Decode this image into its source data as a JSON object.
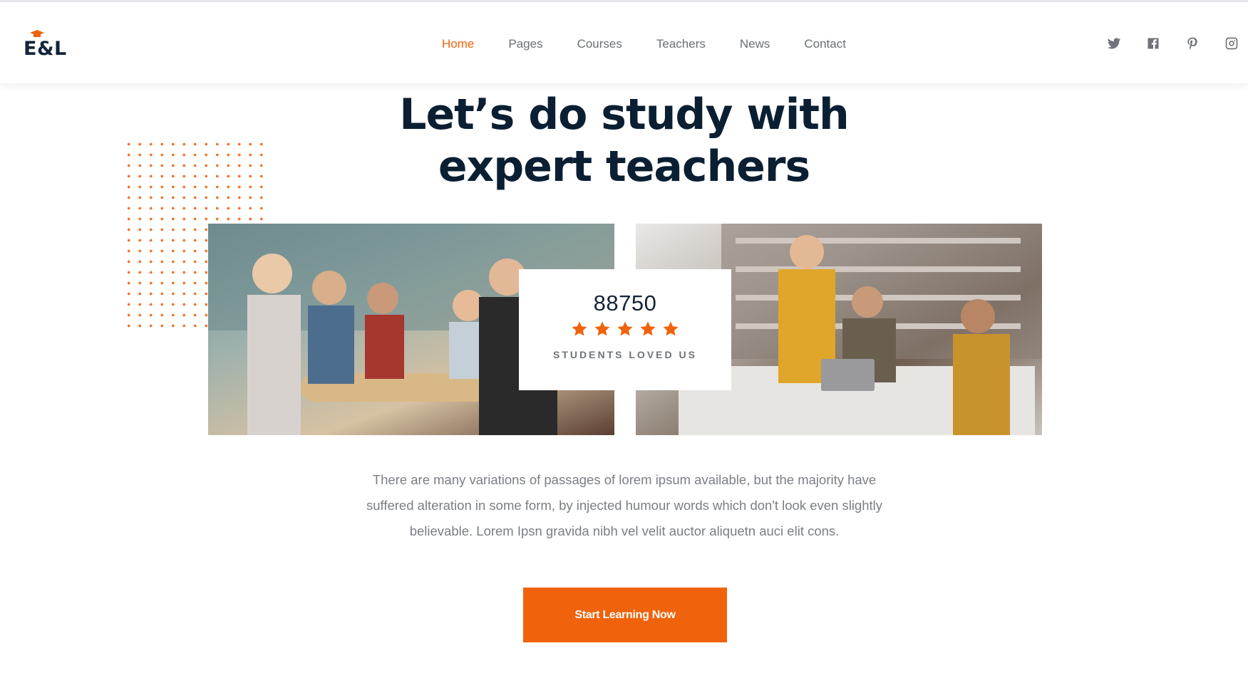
{
  "brand": {
    "logo_text": "E&L",
    "accent_color": "#f0630c",
    "heading_color": "#0b1f33"
  },
  "nav": {
    "items": [
      {
        "label": "Home",
        "active": true
      },
      {
        "label": "Pages",
        "active": false
      },
      {
        "label": "Courses",
        "active": false
      },
      {
        "label": "Teachers",
        "active": false
      },
      {
        "label": "News",
        "active": false
      },
      {
        "label": "Contact",
        "active": false
      }
    ]
  },
  "social": {
    "icons": [
      "twitter-icon",
      "facebook-icon",
      "pinterest-icon",
      "instagram-icon"
    ]
  },
  "hero": {
    "title_line1": "Let’s do study with",
    "title_line2": "expert teachers"
  },
  "images": {
    "left": "students-classroom-photo",
    "right": "students-library-photo"
  },
  "stats": {
    "number": "88750",
    "rating_stars": 5,
    "label": "STUDENTS LOVED US"
  },
  "description": {
    "line1": "There are many variations of passages of lorem ipsum available, but the majority have",
    "line2": "suffered alteration in some form, by injected humour words which don't look even slightly",
    "line3": "believable. Lorem Ipsn gravida nibh vel velit auctor aliquetn auci elit cons."
  },
  "cta": {
    "label": "Start Learning Now"
  }
}
